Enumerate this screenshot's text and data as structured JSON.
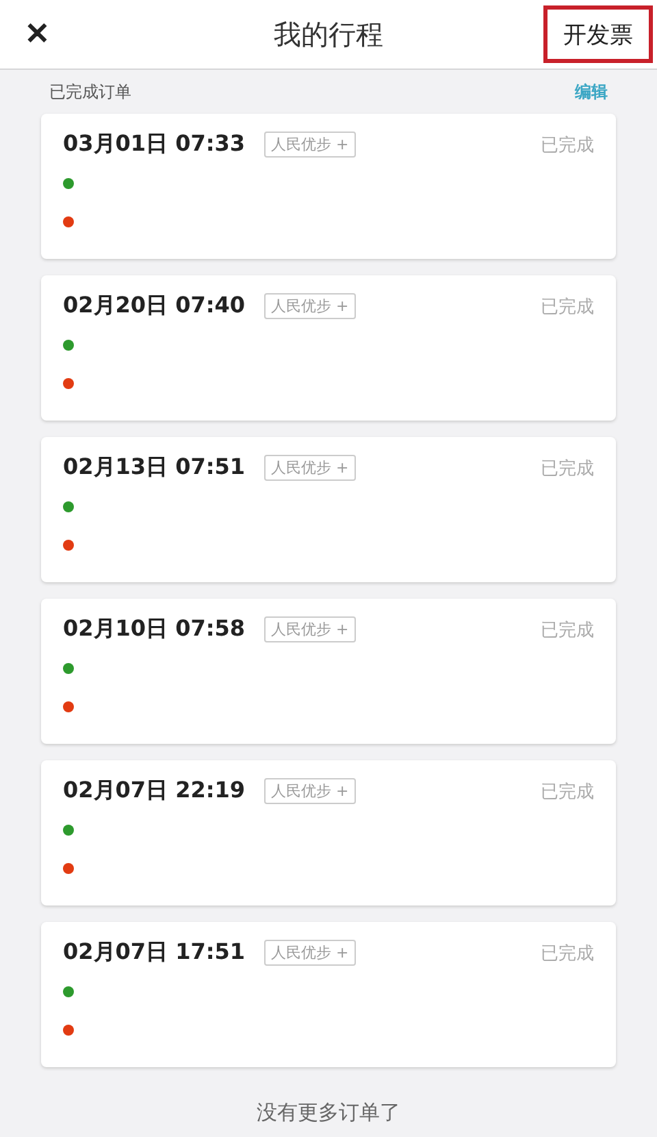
{
  "header": {
    "close": "✕",
    "title": "我的行程",
    "action": {
      "label": "开发票",
      "highlighted": true
    }
  },
  "section": {
    "title": "已完成订单",
    "edit": "编辑"
  },
  "orders": [
    {
      "time": "03月01日 07:33",
      "tag": "人民优步 +",
      "status": "已完成"
    },
    {
      "time": "02月20日 07:40",
      "tag": "人民优步 +",
      "status": "已完成"
    },
    {
      "time": "02月13日 07:51",
      "tag": "人民优步 +",
      "status": "已完成"
    },
    {
      "time": "02月10日 07:58",
      "tag": "人民优步 +",
      "status": "已完成"
    },
    {
      "time": "02月07日 22:19",
      "tag": "人民优步 +",
      "status": "已完成"
    },
    {
      "time": "02月07日 17:51",
      "tag": "人民优步 +",
      "status": "已完成"
    }
  ],
  "footer": "没有更多订单了"
}
